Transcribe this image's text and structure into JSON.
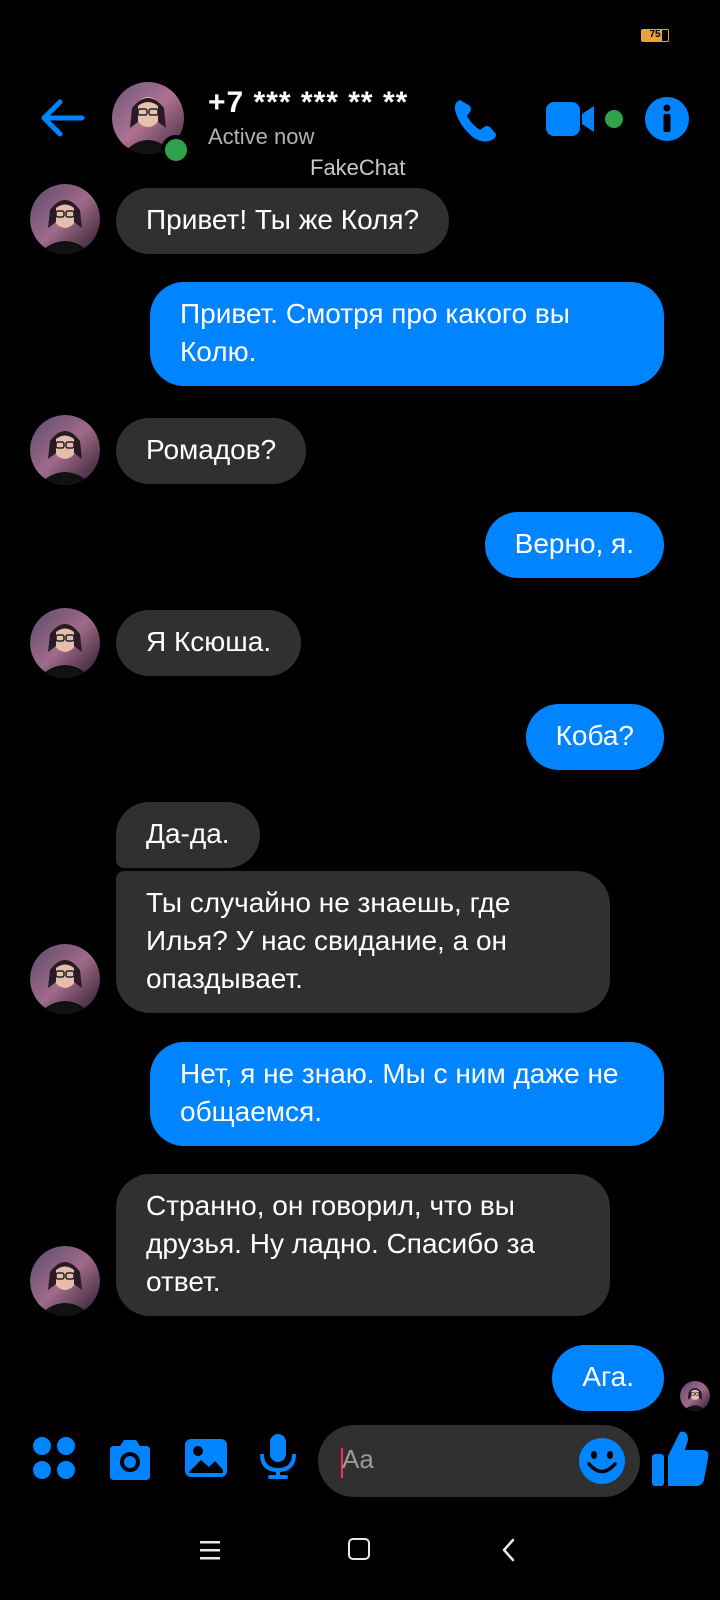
{
  "status_bar": {
    "battery_level": "75"
  },
  "header": {
    "contact_name": "+7 *** *** ** **",
    "status": "Active now",
    "watermark": "FakeChat",
    "accent_color": "#0084ff",
    "online_color": "#31a24c",
    "icons": [
      "back-arrow-icon",
      "phone-icon",
      "video-camera-icon",
      "info-icon"
    ]
  },
  "messages": [
    {
      "side": "incoming",
      "text": "Привет! Ты же Коля?"
    },
    {
      "side": "outgoing",
      "text": "Привет. Смотря про какого вы Колю."
    },
    {
      "side": "incoming",
      "text": "Ромадов?"
    },
    {
      "side": "outgoing",
      "text": "Верно, я."
    },
    {
      "side": "incoming",
      "text": "Я Ксюша."
    },
    {
      "side": "outgoing",
      "text": "Коба?"
    },
    {
      "side": "incoming",
      "text": "Да-да."
    },
    {
      "side": "incoming",
      "text": "Ты случайно не знаешь, где Илья? У нас свидание, а он опаздывает."
    },
    {
      "side": "outgoing",
      "text": "Нет, я не знаю. Мы с ним даже не общаемся."
    },
    {
      "side": "incoming",
      "text": "Странно, он говорил, что вы друзья. Ну ладно. Спасибо за ответ."
    },
    {
      "side": "outgoing",
      "text": "Ага."
    }
  ],
  "composer": {
    "placeholder": "Aa",
    "icons": [
      "menu-dots-icon",
      "camera-icon",
      "gallery-icon",
      "microphone-icon",
      "emoji-icon",
      "thumbs-up-icon"
    ]
  },
  "nav_bar": {
    "icons": [
      "recent-apps-icon",
      "home-icon",
      "back-icon"
    ]
  }
}
